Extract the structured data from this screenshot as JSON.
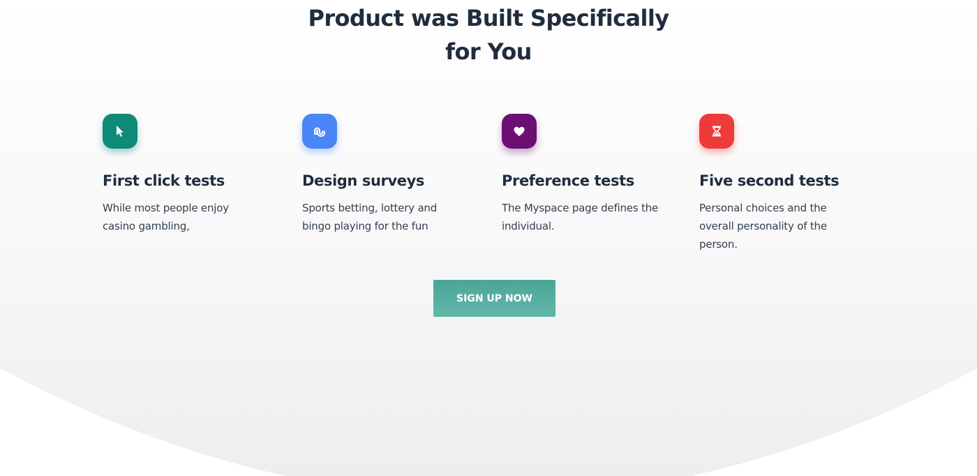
{
  "headline": {
    "line1": "Product  was Built Specifically",
    "line2": "for You"
  },
  "features": [
    {
      "title": "First click tests",
      "text": "While most people enjoy casino gambling,",
      "icon": "cursor-icon",
      "color": "#0f8a77"
    },
    {
      "title": "Design surveys",
      "text": "Sports betting, lottery and bingo playing for the fun",
      "icon": "stumbleupon-icon",
      "color": "#4a86f7"
    },
    {
      "title": "Preference tests",
      "text": "The Myspace page defines the individual.",
      "icon": "heart-icon",
      "color": "#6c0f73"
    },
    {
      "title": "Five second tests",
      "text": "Personal choices and the overall personality of the person.",
      "icon": "hourglass-icon",
      "color": "#ef3a3a"
    }
  ],
  "cta": {
    "label": "SIGN UP NOW",
    "color": "#55ad9f"
  }
}
